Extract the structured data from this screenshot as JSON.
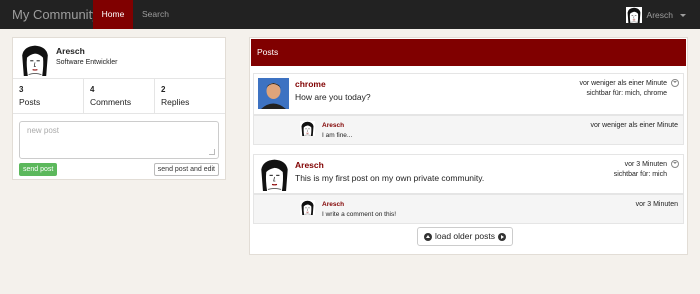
{
  "navbar": {
    "brand": "My Community",
    "home": "Home",
    "search": "Search",
    "user": "Aresch"
  },
  "profile": {
    "name": "Aresch",
    "role": "Software Entwickler",
    "stats": [
      {
        "count": "3",
        "label": "Posts"
      },
      {
        "count": "4",
        "label": "Comments"
      },
      {
        "count": "2",
        "label": "Replies"
      }
    ],
    "new_post_placeholder": "new post",
    "send_label": "send post",
    "send_edit_label": "send post and edit"
  },
  "posts_panel": {
    "title": "Posts",
    "posts": [
      {
        "author": "chrome",
        "text": "How are you today?",
        "time": "vor weniger als einer Minute",
        "visibility": "sichtbar für: mich, chrome",
        "comment": {
          "author": "Aresch",
          "text": "I am fine...",
          "time": "vor weniger als einer Minute"
        }
      },
      {
        "author": "Aresch",
        "text": "This is my first post on my own private community.",
        "time": "vor 3 Minuten",
        "visibility": "sichtbar für: mich",
        "comment": {
          "author": "Aresch",
          "text": "I write a comment on this!",
          "time": "vor 3 Minuten"
        }
      }
    ],
    "load_older": "load older posts"
  },
  "colors": {
    "accent": "#800000",
    "navbar": "#222222",
    "success": "#5cb85c",
    "background": "#f4f1ec"
  },
  "icons": {
    "avatar": "face-drawing-icon",
    "options": "chevron-circle-down-icon",
    "load_left": "arrow-circle-up-icon",
    "load_right": "arrow-circle-right-icon"
  }
}
